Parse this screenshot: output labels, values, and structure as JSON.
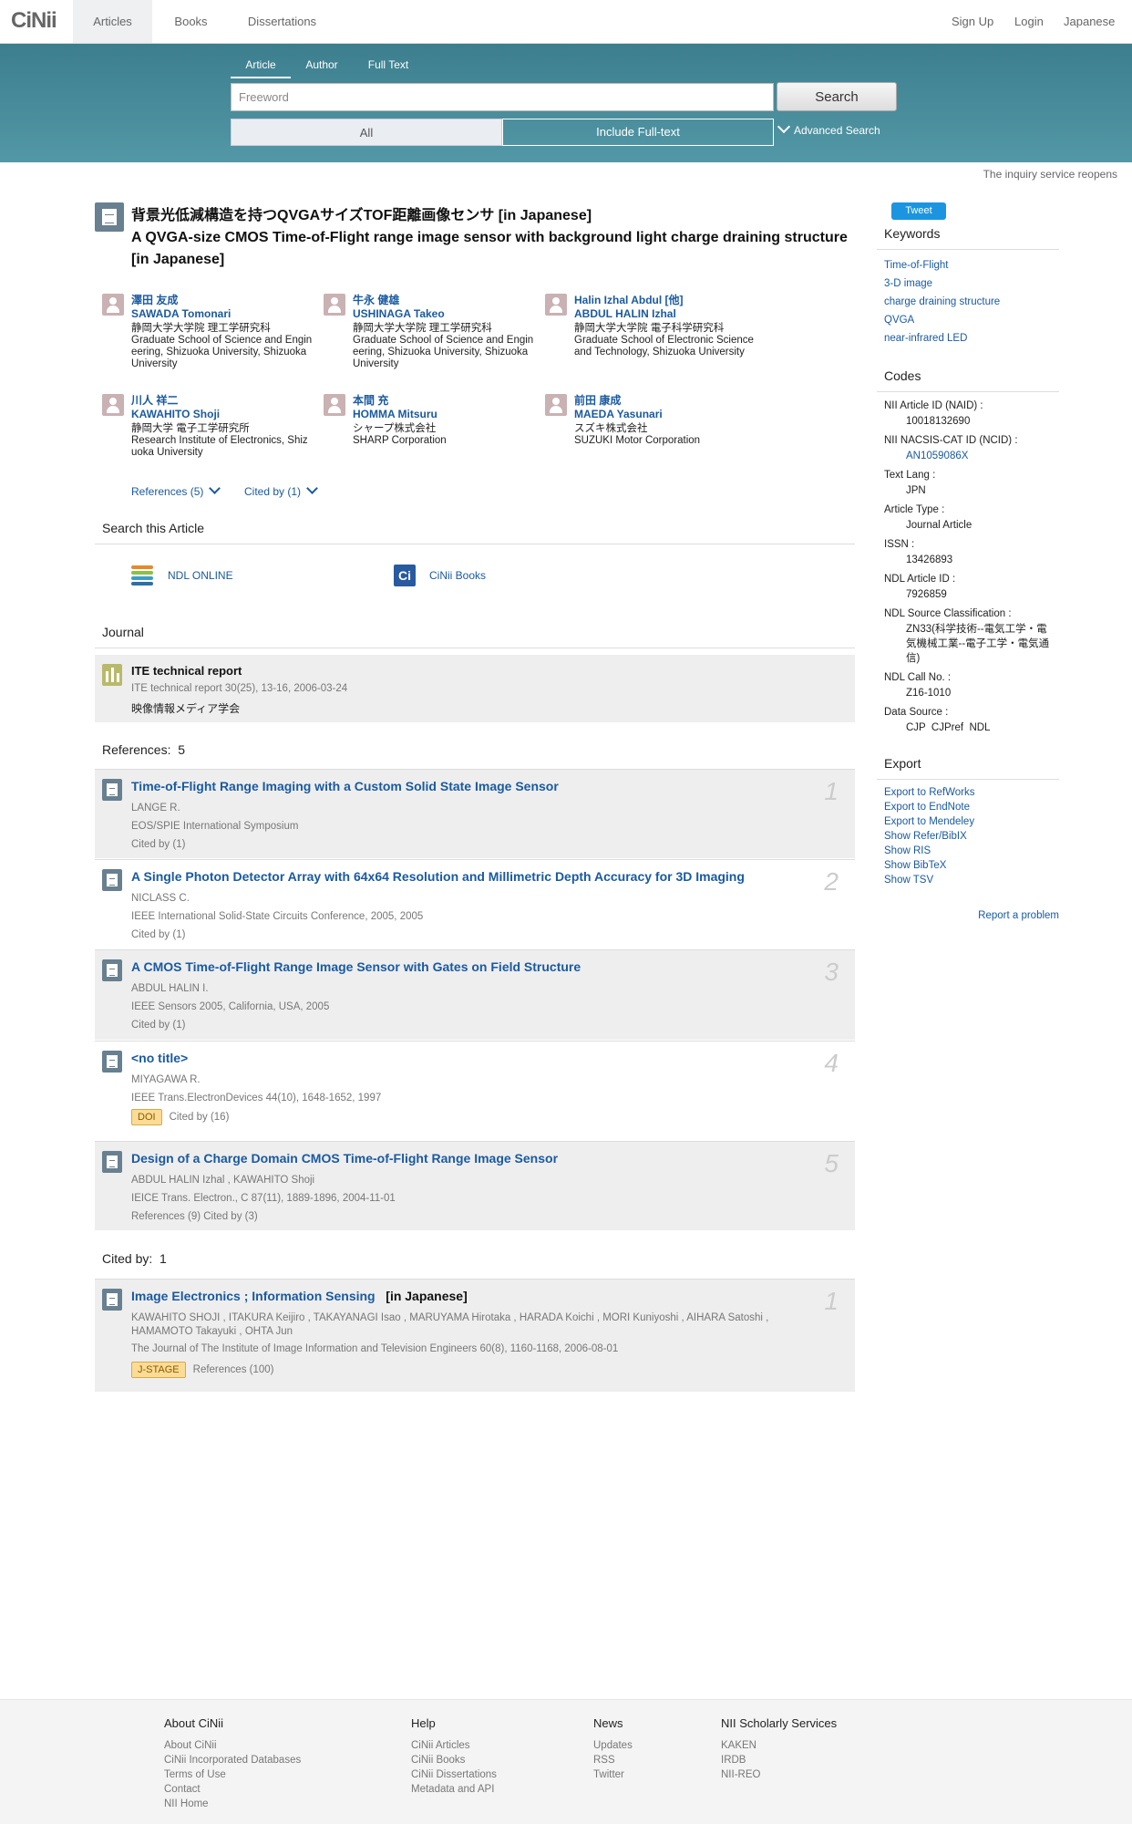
{
  "nav": {
    "logo": "CiNii",
    "tabs": [
      "Articles",
      "Books",
      "Dissertations"
    ],
    "right": [
      "Sign Up",
      "Login",
      "Japanese"
    ]
  },
  "search": {
    "tabs": [
      "Article",
      "Author",
      "Full Text"
    ],
    "placeholder": "Freeword",
    "button": "Search",
    "option_all": "All",
    "option_full": "Include Full-text",
    "advanced": "Advanced Search"
  },
  "notice": "The inquiry service reopens",
  "article": {
    "title_ja": "背景光低減構造を持つQVGAサイズTOF距離画像センサ  [in Japanese]",
    "title_en": "A QVGA-size CMOS Time-of-Flight range image sensor with background light charge draining structure  [in Japanese]",
    "authors": [
      {
        "ja": "澤田 友成",
        "en": "SAWADA Tomonari",
        "aff_ja": "静岡大学大学院 理工学研究科",
        "aff_en": "Graduate School of Science and Engineering, Shizuoka University, Shizuoka University"
      },
      {
        "ja": "牛永 健雄",
        "en": "USHINAGA Takeo",
        "aff_ja": "静岡大学大学院 理工学研究科",
        "aff_en": "Graduate School of Science and Engineering, Shizuoka University, Shizuoka University"
      },
      {
        "ja": "Halin Izhal Abdul [他]",
        "en": "ABDUL HALIN Izhal",
        "aff_ja": "静岡大学大学院 電子科学研究科",
        "aff_en": "Graduate School of Electronic Science and Technology, Shizuoka University"
      },
      {
        "ja": "川人 祥二",
        "en": "KAWAHITO Shoji",
        "aff_ja": "静岡大学 電子工学研究所",
        "aff_en": "Research Institute of Electronics, Shizuoka University"
      },
      {
        "ja": "本間 充",
        "en": "HOMMA Mitsuru",
        "aff_ja": "シャープ株式会社",
        "aff_en": "SHARP Corporation"
      },
      {
        "ja": "前田 康成",
        "en": "MAEDA Yasunari",
        "aff_ja": "スズキ株式会社",
        "aff_en": "SUZUKI Motor Corporation"
      }
    ],
    "references_toggle": "References (5)",
    "cited_toggle": "Cited by (1)"
  },
  "search_article": {
    "heading": "Search this Article",
    "ndl": "NDL ONLINE",
    "cinii_books": "CiNii Books",
    "cinii_icon": "Ci"
  },
  "journal": {
    "heading": "Journal",
    "title": "ITE technical report",
    "info": "ITE technical report 30(25), 13-16, 2006-03-24",
    "publisher": "映像情報メディア学会"
  },
  "references": {
    "label": "References:",
    "count": "5",
    "items": [
      {
        "num": "1",
        "title": "Time-of-Flight Range Imaging with a Custom Solid State Image Sensor",
        "author": "LANGE R.",
        "source": "EOS/SPIE International Symposium",
        "cite": "Cited by (1)"
      },
      {
        "num": "2",
        "title": "A Single Photon Detector Array with 64x64 Resolution and Millimetric Depth Accuracy for 3D Imaging",
        "author": "NICLASS C.",
        "source": "IEEE International Solid-State Circuits Conference, 2005, 2005",
        "cite": "Cited by (1)"
      },
      {
        "num": "3",
        "title": "A CMOS Time-of-Flight Range Image Sensor with Gates on Field Structure",
        "author": "ABDUL HALIN I.",
        "source": "IEEE Sensors 2005, California, USA, 2005",
        "cite": "Cited by (1)"
      },
      {
        "num": "4",
        "title": "<no title>",
        "author": "MIYAGAWA R.",
        "source": "IEEE Trans.ElectronDevices 44(10), 1648-1652, 1997",
        "badge": "DOI",
        "cite": "Cited by (16)"
      },
      {
        "num": "5",
        "title": "Design of a Charge Domain CMOS Time-of-Flight Range Image Sensor",
        "author": "ABDUL HALIN Izhal , KAWAHITO Shoji",
        "source": "IEICE Trans. Electron., C 87(11), 1889-1896, 2004-11-01",
        "cite": "References (9)  Cited by (3)"
      }
    ]
  },
  "cited_by": {
    "label": "Cited by:",
    "count": "1",
    "item": {
      "num": "1",
      "title": "Image Electronics ; Information Sensing",
      "suffix": "[in Japanese]",
      "authors": "KAWAHITO SHOJI , ITAKURA Keijiro , TAKAYANAGI Isao , MARUYAMA Hirotaka , HARADA Koichi , MORI Kuniyoshi , AIHARA Satoshi , HAMAMOTO Takayuki , OHTA Jun",
      "source": "The Journal of The Institute of Image Information and Television Engineers 60(8), 1160-1168, 2006-08-01",
      "badge": "J-STAGE",
      "cite": "References (100)"
    }
  },
  "sidebar": {
    "tweet": "Tweet",
    "keywords_heading": "Keywords",
    "keywords": [
      "Time-of-Flight",
      "3-D image",
      "charge draining structure",
      "QVGA",
      "near-infrared LED"
    ],
    "codes_heading": "Codes",
    "codes": [
      {
        "label": "NII Article ID (NAID) :",
        "value": "10018132690"
      },
      {
        "label": "NII NACSIS-CAT ID (NCID) :",
        "value": "AN1059086X",
        "link": true
      },
      {
        "label": "Text Lang :",
        "value": "JPN"
      },
      {
        "label": "Article Type :",
        "value": "Journal Article"
      },
      {
        "label": "ISSN :",
        "value": "13426893"
      },
      {
        "label": "NDL Article ID :",
        "value": "7926859"
      },
      {
        "label": "NDL Source Classification :",
        "value": "ZN33(科学技術--電気工学・電気機械工業--電子工学・電気通信)"
      },
      {
        "label": "NDL Call No. :",
        "value": "Z16-1010"
      },
      {
        "label": "Data Source :",
        "value": "CJP  CJPref  NDL"
      }
    ],
    "export_heading": "Export",
    "exports": [
      "Export to RefWorks",
      "Export to EndNote",
      "Export to Mendeley",
      "Show Refer/BibIX",
      "Show RIS",
      "Show BibTeX",
      "Show TSV"
    ],
    "report": "Report a problem"
  },
  "footer": {
    "cols": [
      {
        "head": "About CiNii",
        "links": [
          "About CiNii",
          "CiNii Incorporated Databases",
          "Terms of Use",
          "Contact",
          "NII Home"
        ]
      },
      {
        "head": "Help",
        "links": [
          "CiNii Articles",
          "CiNii Books",
          "CiNii Dissertations",
          "Metadata and API"
        ]
      },
      {
        "head": "News",
        "links": [
          "Updates",
          "RSS",
          "Twitter"
        ]
      },
      {
        "head": "NII Scholarly Services",
        "links": [
          "KAKEN",
          "IRDB",
          "NII-REO"
        ]
      }
    ]
  }
}
